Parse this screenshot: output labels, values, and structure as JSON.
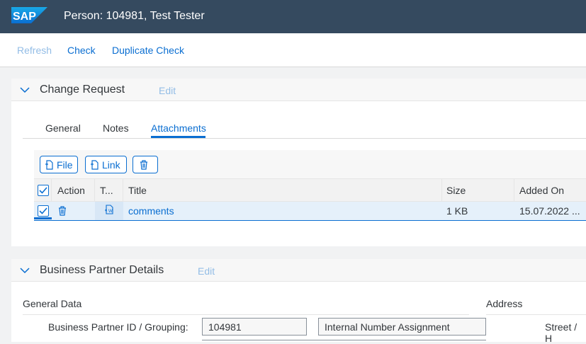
{
  "shell": {
    "logo_text": "SAP",
    "title": "Person: 104981, Test Tester"
  },
  "toolbar": {
    "refresh": "Refresh",
    "check": "Check",
    "duplicate_check": "Duplicate Check"
  },
  "change_request": {
    "title": "Change Request",
    "edit": "Edit",
    "tabs": [
      "General",
      "Notes",
      "Attachments"
    ],
    "active_tab": "Attachments",
    "buttons": {
      "file": "File",
      "link": "Link"
    },
    "columns": {
      "action": "Action",
      "type": "T...",
      "title": "Title",
      "size": "Size",
      "added_on": "Added On"
    },
    "rows": [
      {
        "selected": true,
        "title": "comments",
        "size": "1 KB",
        "added_on": "15.07.2022 ..."
      }
    ]
  },
  "bp_details": {
    "title": "Business Partner Details",
    "edit": "Edit",
    "general_data": "General Data",
    "address": "Address",
    "bp_id_label": "Business Partner ID / Grouping:",
    "bp_id_value": "104981",
    "grouping_value": "Internal Number Assignment",
    "street_label": "Street / H"
  },
  "colors": {
    "shell": "#354a5f",
    "accent": "#0a6ed1",
    "disabled": "#93bde6",
    "selected_row": "#e5f0fa"
  }
}
